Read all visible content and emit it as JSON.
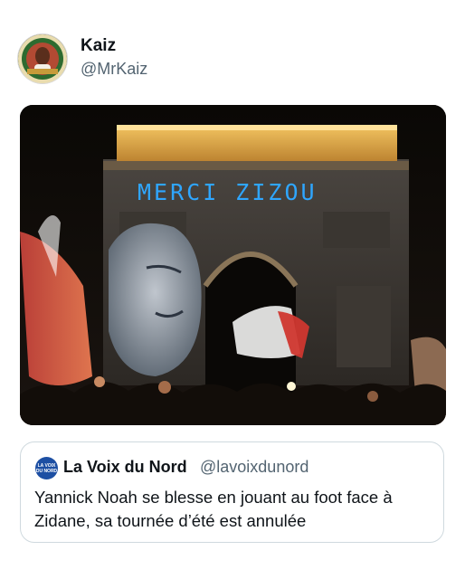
{
  "author": {
    "name": "Kaiz",
    "handle": "@MrKaiz",
    "avatar_icon": "profile-photo-avatar"
  },
  "media": {
    "projection_text": "MERCI  ZIZOU"
  },
  "quoted_post": {
    "name": "La Voix du Nord",
    "handle": "@lavoixdunord",
    "avatar_text": "LA VOIX DU NORD",
    "text": "Yannick Noah se blesse en jouant au foot face à Zidane, sa tournée d’été est annulée"
  },
  "colors": {
    "text_primary": "#0f1419",
    "text_secondary": "#536471",
    "border": "#cfd9de",
    "projection_blue": "#2fa6ff"
  }
}
